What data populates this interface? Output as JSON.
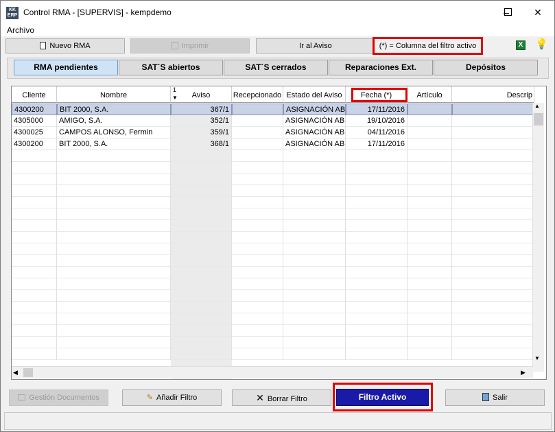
{
  "window": {
    "title": "Control RMA - [SUPERVIS] - kempdemo",
    "app_icon_text": "KK ERP"
  },
  "menu": {
    "items": [
      "Archivo"
    ]
  },
  "toolbar": {
    "new_rma": "Nuevo RMA",
    "print": "Imprimir",
    "go_to_notice": "Ir al Aviso",
    "filter_hint": "(*) = Columna del filtro activo"
  },
  "tabs": [
    "RMA pendientes",
    "SAT´S abiertos",
    "SAT´S cerrados",
    "Reparaciones Ext.",
    "Depósitos"
  ],
  "grid": {
    "sort_indicator": "1",
    "columns": [
      "Cliente",
      "Nombre",
      "Aviso",
      "Recepcionado",
      "Estado del Aviso",
      "Fecha (*)",
      "Artículo",
      "Descrip"
    ],
    "rows": [
      [
        "4300200",
        "BIT 2000, S.A.",
        "367/1",
        "",
        "ASIGNACIÓN ABI",
        "17/11/2016",
        "",
        ""
      ],
      [
        "4305000",
        "AMIGO, S.A.",
        "352/1",
        "",
        "ASIGNACIÓN ABI",
        "19/10/2016",
        "",
        ""
      ],
      [
        "4300025",
        "CAMPOS ALONSO, Fermin",
        "359/1",
        "",
        "ASIGNACIÓN ABI",
        "04/11/2016",
        "",
        ""
      ],
      [
        "4300200",
        "BIT 2000, S.A.",
        "368/1",
        "",
        "ASIGNACIÓN ABI",
        "17/11/2016",
        "",
        ""
      ]
    ]
  },
  "actions": {
    "documents": "Gestión Documentos",
    "add_filter": "Añadir Filtro",
    "clear_filter": "Borrar Filtro",
    "active_filter": "Filtro Activo",
    "exit": "Salir"
  },
  "colors": {
    "highlight_red": "#e00000",
    "active_filter_bg": "#1a1aa8",
    "selected_row": "#c9d3e6"
  }
}
